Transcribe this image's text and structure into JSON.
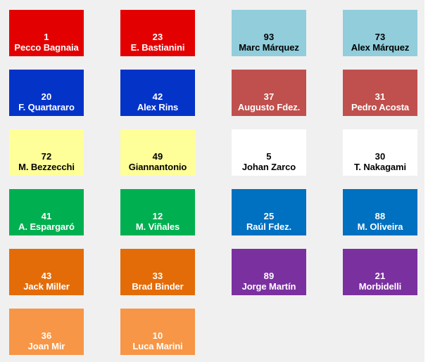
{
  "page": {
    "title": "MotoGP Rider Grid",
    "background_color": "#f0f0f0"
  },
  "palette": {
    "red": "#E30000",
    "light_blue": "#92CDDC",
    "dark_blue": "#0433C8",
    "brick_red": "#C0504D",
    "yellow": "#FFFF99",
    "white": "#FFFFFF",
    "green": "#00B050",
    "medium_blue": "#0070C0",
    "orange": "#E36C09",
    "purple": "#7B30A0",
    "light_orange": "#F79646",
    "text_light": "#FFFFFF",
    "text_dark": "#000000"
  },
  "grid": {
    "columns": 4,
    "rows": 6,
    "tiles": [
      {
        "number": "1",
        "name": "Pecco Bagnaia",
        "bg": "#E30000",
        "fg": "#FFFFFF",
        "empty": false
      },
      {
        "number": "23",
        "name": "E. Bastianini",
        "bg": "#E30000",
        "fg": "#FFFFFF",
        "empty": false
      },
      {
        "number": "93",
        "name": "Marc Márquez",
        "bg": "#92CDDC",
        "fg": "#000000",
        "empty": false
      },
      {
        "number": "73",
        "name": "Alex Márquez",
        "bg": "#92CDDC",
        "fg": "#000000",
        "empty": false
      },
      {
        "number": "20",
        "name": "F. Quartararo",
        "bg": "#0433C8",
        "fg": "#FFFFFF",
        "empty": false
      },
      {
        "number": "42",
        "name": "Alex Rins",
        "bg": "#0433C8",
        "fg": "#FFFFFF",
        "empty": false
      },
      {
        "number": "37",
        "name": "Augusto Fdez.",
        "bg": "#C0504D",
        "fg": "#FFFFFF",
        "empty": false
      },
      {
        "number": "31",
        "name": "Pedro Acosta",
        "bg": "#C0504D",
        "fg": "#FFFFFF",
        "empty": false
      },
      {
        "number": "72",
        "name": "M. Bezzecchi",
        "bg": "#FFFF99",
        "fg": "#000000",
        "empty": false
      },
      {
        "number": "49",
        "name": "Giannantonio",
        "bg": "#FFFF99",
        "fg": "#000000",
        "empty": false
      },
      {
        "number": "5",
        "name": "Johan Zarco",
        "bg": "#FFFFFF",
        "fg": "#000000",
        "empty": false
      },
      {
        "number": "30",
        "name": "T. Nakagami",
        "bg": "#FFFFFF",
        "fg": "#000000",
        "empty": false
      },
      {
        "number": "41",
        "name": "A. Espargaró",
        "bg": "#00B050",
        "fg": "#FFFFFF",
        "empty": false
      },
      {
        "number": "12",
        "name": "M. Viñales",
        "bg": "#00B050",
        "fg": "#FFFFFF",
        "empty": false
      },
      {
        "number": "25",
        "name": "Raúl Fdez.",
        "bg": "#0070C0",
        "fg": "#FFFFFF",
        "empty": false
      },
      {
        "number": "88",
        "name": "M. Oliveira",
        "bg": "#0070C0",
        "fg": "#FFFFFF",
        "empty": false
      },
      {
        "number": "43",
        "name": "Jack Miller",
        "bg": "#E36C09",
        "fg": "#FFFFFF",
        "empty": false
      },
      {
        "number": "33",
        "name": "Brad Binder",
        "bg": "#E36C09",
        "fg": "#FFFFFF",
        "empty": false
      },
      {
        "number": "89",
        "name": "Jorge Martín",
        "bg": "#7B30A0",
        "fg": "#FFFFFF",
        "empty": false
      },
      {
        "number": "21",
        "name": "Morbidelli",
        "bg": "#7B30A0",
        "fg": "#FFFFFF",
        "empty": false
      },
      {
        "number": "36",
        "name": "Joan Mir",
        "bg": "#F79646",
        "fg": "#FFFFFF",
        "empty": false
      },
      {
        "number": "10",
        "name": "Luca Marini",
        "bg": "#F79646",
        "fg": "#FFFFFF",
        "empty": false
      },
      {
        "number": "",
        "name": "",
        "bg": "transparent",
        "fg": "#000000",
        "empty": true
      },
      {
        "number": "",
        "name": "",
        "bg": "transparent",
        "fg": "#000000",
        "empty": true
      }
    ]
  }
}
